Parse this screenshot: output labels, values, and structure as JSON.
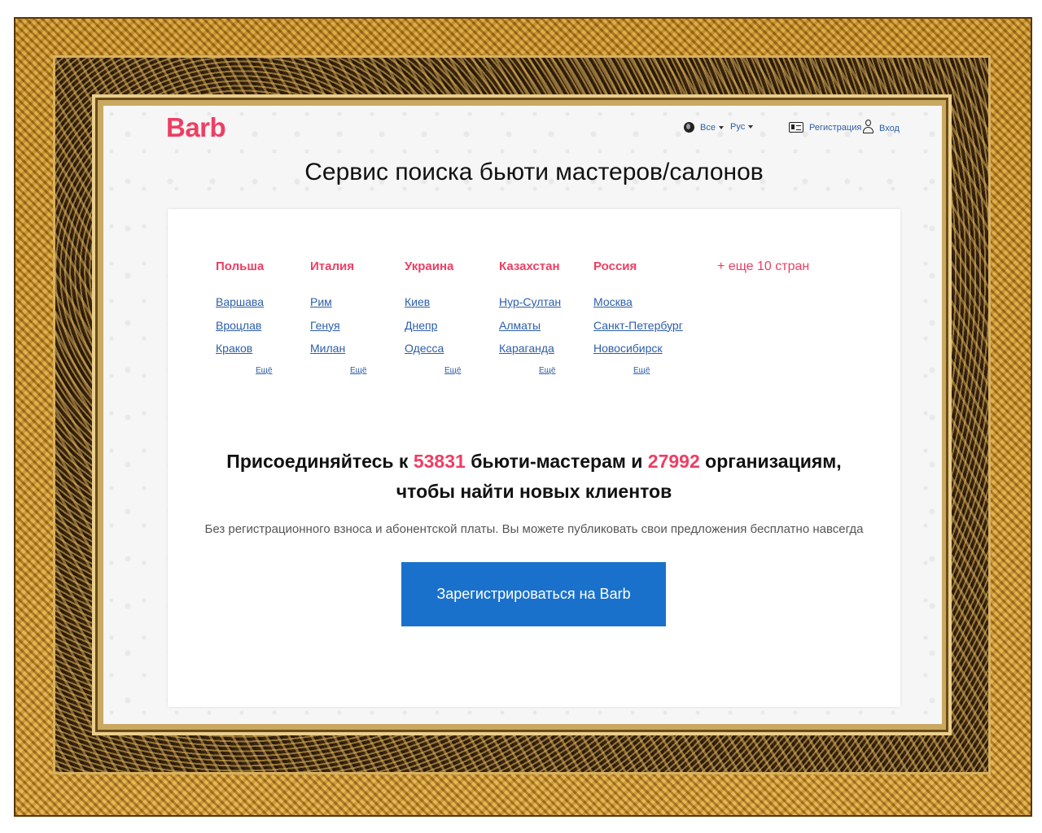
{
  "header": {
    "logo": "Barb",
    "filter_all": "Все",
    "language": "Рус",
    "register": "Регистрация",
    "login": "Вход"
  },
  "headline": "Сервис поиска бьюти мастеров/салонов",
  "countries": [
    {
      "name": "Польша",
      "cities": [
        "Варшава",
        "Вроцлав",
        "Краков"
      ],
      "more": "Ещё"
    },
    {
      "name": "Италия",
      "cities": [
        "Рим",
        "Генуя",
        "Милан"
      ],
      "more": "Ещё"
    },
    {
      "name": "Украина",
      "cities": [
        "Киев",
        "Днепр",
        "Одесса"
      ],
      "more": "Ещё"
    },
    {
      "name": "Казахстан",
      "cities": [
        "Нур-Султан",
        "Алматы",
        "Караганда"
      ],
      "more": "Ещё"
    },
    {
      "name": "Россия",
      "cities": [
        "Москва",
        "Санкт-Петербург",
        "Новосибирск"
      ],
      "more": "Ещё"
    }
  ],
  "more_countries": "+ еще 10 стран",
  "join": {
    "prefix": "Присоединяйтесь к",
    "masters_count": "53831",
    "middle": "бьюти-мастерам и",
    "orgs_count": "27992",
    "suffix": "организациям,",
    "line2": "чтобы найти новых клиентов"
  },
  "subtext": "Без регистрационного взноса и абонентской платы. Вы можете публиковать свои предложения бесплатно навсегда",
  "cta_label": "Зарегистрироваться на Barb",
  "colors": {
    "accent": "#ee3e63",
    "link": "#2c5ea8",
    "button": "#1a71cc"
  }
}
